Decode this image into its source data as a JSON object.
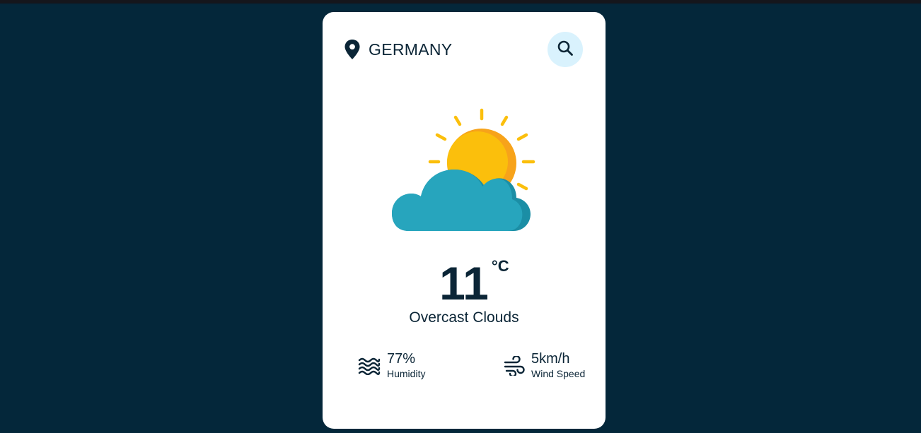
{
  "location": {
    "name": "GERMANY",
    "icon": "map-pin-icon"
  },
  "search": {
    "icon": "search-icon"
  },
  "weather": {
    "icon": "sun-behind-cloud-icon",
    "temperature": "11",
    "unit": "°C",
    "description": "Overcast Clouds"
  },
  "stats": {
    "humidity": {
      "value": "77%",
      "label": "Humidity",
      "icon": "waves-icon"
    },
    "wind": {
      "value": "5km/h",
      "label": "Wind Speed",
      "icon": "wind-icon"
    }
  },
  "colors": {
    "background": "#04273a",
    "card": "#ffffff",
    "text": "#0b2536",
    "search_bg": "#d9f2fd",
    "sun": "#fbbf0c",
    "sun_shade": "#f7a31a",
    "cloud": "#27a5bd",
    "cloud_shade": "#1b8ea5"
  }
}
